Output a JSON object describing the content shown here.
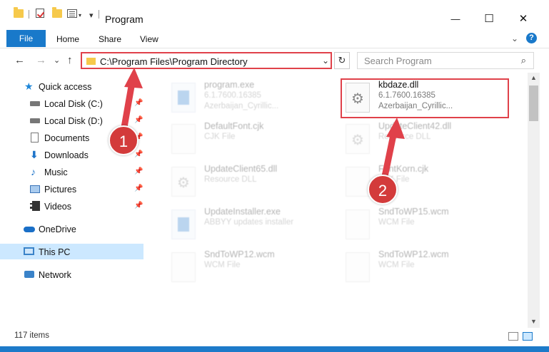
{
  "window": {
    "title": "Program",
    "minimize_glyph": "—",
    "maximize_glyph": "☐",
    "close_glyph": "✕",
    "qa_dropdown_glyph": "▾"
  },
  "ribbon": {
    "file_tab": "File",
    "tabs": [
      "Home",
      "Share",
      "View"
    ],
    "collapse_glyph": "⌄",
    "help_glyph": "?"
  },
  "nav": {
    "back_glyph": "←",
    "forward_glyph": "→",
    "recent_glyph": "⌄",
    "up_glyph": "↑",
    "address": "C:\\Program Files\\Program Directory",
    "address_dropdown_glyph": "⌄",
    "refresh_glyph": "↻",
    "search_placeholder": "Search Program",
    "search_glyph": "⌕"
  },
  "sidebar": {
    "pin_glyph": "📌",
    "star_glyph": "★",
    "down_glyph": "⬇",
    "music_glyph": "♪",
    "items": [
      {
        "label": "Quick access",
        "icon": "star-icon"
      },
      {
        "label": "Local Disk (C:)",
        "icon": "disk-icon",
        "pinned": true
      },
      {
        "label": "Local Disk (D:)",
        "icon": "disk-icon",
        "pinned": true
      },
      {
        "label": "Documents",
        "icon": "documents-icon",
        "pinned": true
      },
      {
        "label": "Downloads",
        "icon": "downloads-icon",
        "pinned": true
      },
      {
        "label": "Music",
        "icon": "music-icon",
        "pinned": true
      },
      {
        "label": "Pictures",
        "icon": "pictures-icon",
        "pinned": true
      },
      {
        "label": "Videos",
        "icon": "videos-icon",
        "pinned": true
      },
      {
        "label": "OneDrive",
        "icon": "onedrive-icon"
      },
      {
        "label": "This PC",
        "icon": "pc-icon",
        "selected": true
      },
      {
        "label": "Network",
        "icon": "network-icon"
      }
    ]
  },
  "files": [
    {
      "name": "program.exe",
      "line1": "6.1.7600.16385",
      "line2": "Azerbaijan_Cyrillic...",
      "icon": "exe-file-icon"
    },
    {
      "name": "kbdaze.dll",
      "line1": "6.1.7600.16385",
      "line2": "Azerbaijan_Cyrillic...",
      "icon": "dll-file-icon"
    },
    {
      "name": "DefaultFont.cjk",
      "line1": "CJK File",
      "line2": "",
      "icon": "blank-file-icon"
    },
    {
      "name": "UpdateClient42.dll",
      "line1": "Resource DLL",
      "line2": "",
      "icon": "dll-file-icon"
    },
    {
      "name": "UpdateClient65.dll",
      "line1": "Resource DLL",
      "line2": "",
      "icon": "dll-file-icon"
    },
    {
      "name": "FontKorn.cjk",
      "line1": "CJK File",
      "line2": "",
      "icon": "blank-file-icon"
    },
    {
      "name": "UpdateInstaller.exe",
      "line1": "ABBYY updates installer",
      "line2": "",
      "icon": "exe-file-icon"
    },
    {
      "name": "SndToWP15.wcm",
      "line1": "WCM File",
      "line2": "",
      "icon": "blank-file-icon"
    },
    {
      "name": "SndToWP12.wcm",
      "line1": "WCM File",
      "line2": "",
      "icon": "blank-file-icon"
    },
    {
      "name": "SndToWP12.wcm",
      "line1": "WCM File",
      "line2": "",
      "icon": "blank-file-icon"
    }
  ],
  "scroll": {
    "up_glyph": "▲",
    "down_glyph": "▼"
  },
  "status": {
    "item_count": "117 items"
  },
  "annotations": {
    "step1": "1",
    "step2": "2",
    "accent": "#e0414a"
  }
}
